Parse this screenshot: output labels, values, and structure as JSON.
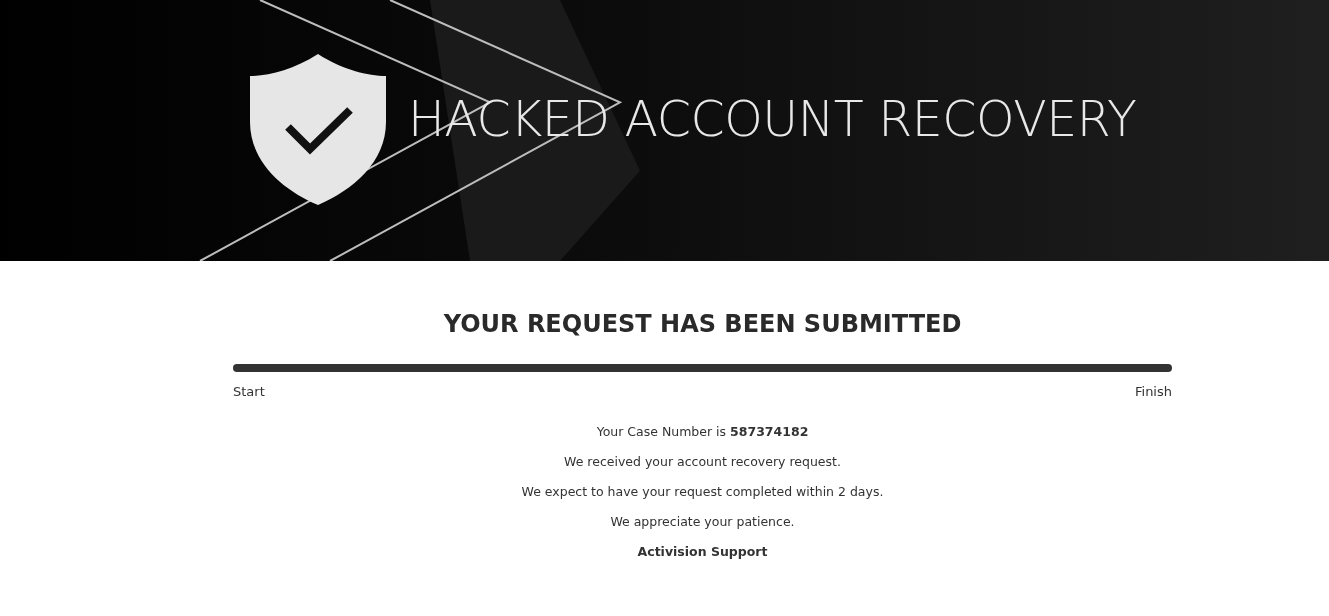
{
  "banner": {
    "title": "HACKED ACCOUNT RECOVERY"
  },
  "heading": "YOUR REQUEST HAS BEEN SUBMITTED",
  "progress": {
    "level": 1,
    "start_label": "Start",
    "end_label": "Finish"
  },
  "message": [
    "Your Case Number is **587374182**",
    "We received your account recovery request.",
    "We expect to have your request completed within 2 days.",
    "We appreciate your patience."
  ],
  "signature": "Activision Support"
}
